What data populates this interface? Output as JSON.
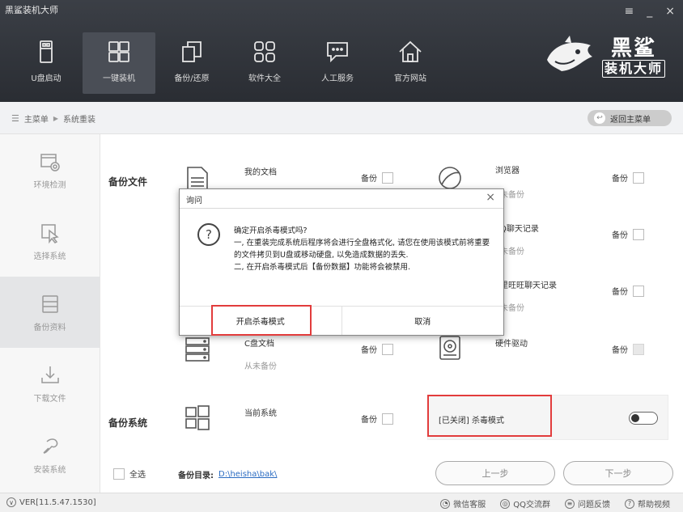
{
  "app": {
    "title": "黑鲨装机大师",
    "window_controls": [
      "≡",
      "_",
      "×"
    ],
    "brand_big": "黑鲨",
    "brand_small": "装机大师"
  },
  "nav": [
    {
      "label": "U盘启动",
      "icon": "usb-icon"
    },
    {
      "label": "一键装机",
      "icon": "windows-icon",
      "active": true
    },
    {
      "label": "备份/还原",
      "icon": "backup-restore-icon"
    },
    {
      "label": "软件大全",
      "icon": "apps-grid-icon"
    },
    {
      "label": "人工服务",
      "icon": "chat-service-icon"
    },
    {
      "label": "官方网站",
      "icon": "home-icon"
    }
  ],
  "breadcrumb": {
    "root": "主菜单",
    "current": "系统重装"
  },
  "back_button": "返回主菜单",
  "sidebar": [
    {
      "label": "环境检测",
      "icon": "env-check-icon"
    },
    {
      "label": "选择系统",
      "icon": "select-system-icon"
    },
    {
      "label": "备份资料",
      "icon": "backup-data-icon",
      "active": true
    },
    {
      "label": "下载文件",
      "icon": "download-icon"
    },
    {
      "label": "安装系统",
      "icon": "install-icon"
    }
  ],
  "main": {
    "backup_files_label": "备份文件",
    "backup_system_label": "备份系统",
    "backup_word": "备份",
    "items": {
      "my_docs": {
        "title": "我的文档"
      },
      "browser": {
        "title": "浏览器",
        "sub": "未备份"
      },
      "qq": {
        "title": "Q聊天记录",
        "sub": "未备份"
      },
      "wangwang": {
        "title": "里旺旺聊天记录",
        "sub": "未备份"
      },
      "c_docs": {
        "title": "C盘文档",
        "sub": "从未备份"
      },
      "drivers": {
        "title": "硬件驱动"
      },
      "current_system": {
        "title": "当前系统"
      }
    },
    "antivirus_status": "[已关闭] 杀毒模式",
    "select_all": "全选",
    "backup_dir_label": "备份目录:",
    "backup_dir_path": "D:\\heisha\\bak\\",
    "prev": "上一步",
    "next": "下一步"
  },
  "status": {
    "version": "VER[11.5.47.1530]",
    "links": [
      {
        "label": "微信客服",
        "icon": "wechat-icon"
      },
      {
        "label": "QQ交流群",
        "icon": "qq-icon"
      },
      {
        "label": "问题反馈",
        "icon": "feedback-icon"
      },
      {
        "label": "帮助视频",
        "icon": "help-icon"
      }
    ]
  },
  "dialog": {
    "title": "询问",
    "close": "×",
    "question_icon": "?",
    "line1": "确定开启杀毒模式吗?",
    "line2": "一, 在重装完成系统后程序将会进行全盘格式化, 请您在使用该模式前将重要的文件拷贝到U盘或移动硬盘, 以免造成数据的丢失.",
    "line3": "二, 在开启杀毒模式后【备份数据】功能将会被禁用.",
    "confirm": "开启杀毒模式",
    "cancel": "取消"
  },
  "colors": {
    "accent_red": "#e23c3c",
    "topbar": "#2f3238",
    "link_blue": "#2b6cc2"
  }
}
